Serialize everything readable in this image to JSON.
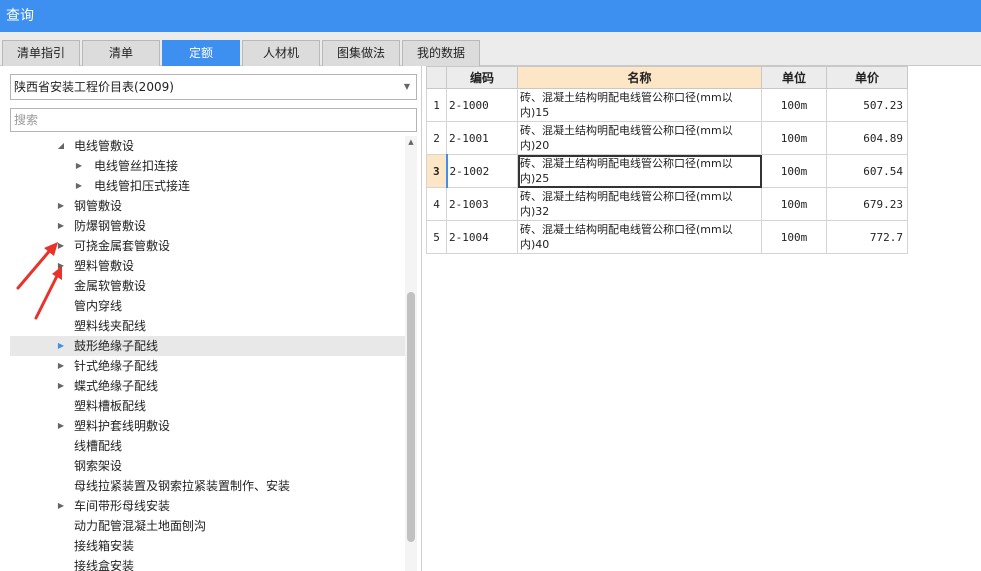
{
  "window": {
    "title": "查询"
  },
  "tabs": [
    {
      "label": "清单指引",
      "active": false
    },
    {
      "label": "清单",
      "active": false
    },
    {
      "label": "定额",
      "active": true
    },
    {
      "label": "人材机",
      "active": false
    },
    {
      "label": "图集做法",
      "active": false
    },
    {
      "label": "我的数据",
      "active": false
    }
  ],
  "left_panel": {
    "library_select": {
      "value": "陕西省安装工程价目表(2009)"
    },
    "search": {
      "placeholder": "搜索",
      "value": ""
    },
    "tree": [
      {
        "label": "电线管敷设",
        "expander": "expanded"
      },
      {
        "label": "电线管丝扣连接",
        "expander": "collapsed"
      },
      {
        "label": "电线管扣压式接连",
        "expander": "collapsed"
      },
      {
        "label": "钢管敷设",
        "expander": "collapsed"
      },
      {
        "label": "防爆钢管敷设",
        "expander": "collapsed"
      },
      {
        "label": "可挠金属套管敷设",
        "expander": "collapsed"
      },
      {
        "label": "塑料管敷设",
        "expander": "collapsed"
      },
      {
        "label": "金属软管敷设",
        "expander": "none"
      },
      {
        "label": "管内穿线",
        "expander": "none"
      },
      {
        "label": "塑料线夹配线",
        "expander": "none"
      },
      {
        "label": "鼓形绝缘子配线",
        "expander": "collapsed",
        "selected": true
      },
      {
        "label": "针式绝缘子配线",
        "expander": "collapsed"
      },
      {
        "label": "蝶式绝缘子配线",
        "expander": "collapsed"
      },
      {
        "label": "塑料槽板配线",
        "expander": "none"
      },
      {
        "label": "塑料护套线明敷设",
        "expander": "collapsed"
      },
      {
        "label": "线槽配线",
        "expander": "none"
      },
      {
        "label": "钢索架设",
        "expander": "none"
      },
      {
        "label": "母线拉紧装置及钢索拉紧装置制作、安装",
        "expander": "none"
      },
      {
        "label": "车间带形母线安装",
        "expander": "collapsed"
      },
      {
        "label": "动力配管混凝土地面刨沟",
        "expander": "none"
      },
      {
        "label": "接线箱安装",
        "expander": "none"
      },
      {
        "label": "接线盒安装",
        "expander": "none"
      }
    ]
  },
  "table": {
    "columns": [
      "",
      "编码",
      "名称",
      "单位",
      "单价"
    ],
    "rows": [
      {
        "index": "1",
        "code": "2-1000",
        "name": "砖、混凝土结构明配电线管公称口径(mm以内)15",
        "unit": "100m",
        "price": "507.23"
      },
      {
        "index": "2",
        "code": "2-1001",
        "name": "砖、混凝土结构明配电线管公称口径(mm以内)20",
        "unit": "100m",
        "price": "604.89"
      },
      {
        "index": "3",
        "code": "2-1002",
        "name": "砖、混凝土结构明配电线管公称口径(mm以内)25",
        "unit": "100m",
        "price": "607.54",
        "current": true
      },
      {
        "index": "4",
        "code": "2-1003",
        "name": "砖、混凝土结构明配电线管公称口径(mm以内)32",
        "unit": "100m",
        "price": "679.23"
      },
      {
        "index": "5",
        "code": "2-1004",
        "name": "砖、混凝土结构明配电线管公称口径(mm以内)40",
        "unit": "100m",
        "price": "772.7"
      }
    ]
  },
  "colors": {
    "accent": "#3d8ff0",
    "header_highlight": "#fde6c6",
    "annotation_arrow": "#e8322a"
  },
  "icons": {
    "expanded": "triangle-down-icon",
    "collapsed": "triangle-right-icon",
    "dropdown": "chevron-down-icon",
    "scroll_up": "scroll-up-icon"
  }
}
